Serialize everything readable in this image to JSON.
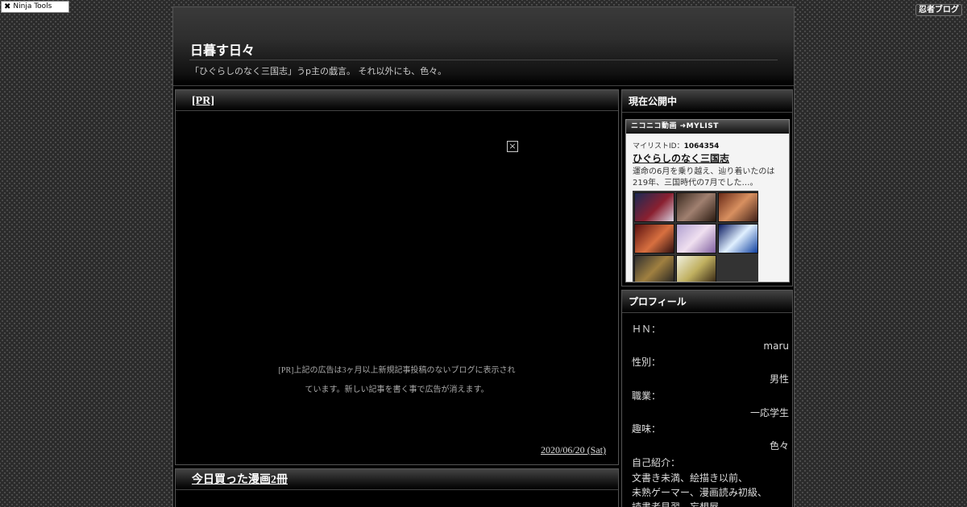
{
  "toolbar": {
    "ninja_tools_label": "Ninja Tools",
    "ninja_blog_label": "忍者ブログ"
  },
  "header": {
    "title": "日暮す日々",
    "description": "「ひぐらしのなく三国志」うp主の戯言。 それ以外にも、色々。"
  },
  "entries": [
    {
      "title": "[PR]",
      "ad_close": "×",
      "notice_line1": "[PR]上記の広告は3ヶ月以上新規記事投稿のないブログに表示され",
      "notice_line2": "ています。新しい記事を書く事で広告が消えます。",
      "date": "2020/06/20 (Sat)"
    },
    {
      "title": "今日買った漫画2冊"
    }
  ],
  "sidebar": {
    "now_public": {
      "heading": "現在公開中",
      "widget_bar": "ニコニコ動画  ➜MYLIST",
      "mylist_id_label": "マイリストID：",
      "mylist_id": "1064354",
      "title": "ひぐらしのなく三国志",
      "description_line1": "運命の6月を乗り越え、辿り着いたのは",
      "description_line2": "219年、三国時代の7月でした…。"
    },
    "profile": {
      "heading": "プロフィール",
      "hn_label": "ＨＮ：",
      "hn_value": "maru",
      "gender_label": "性別：",
      "gender_value": "男性",
      "job_label": "職業：",
      "job_value": "一応学生",
      "hobby_label": "趣味：",
      "hobby_value": "色々",
      "intro_label": "自己紹介：",
      "intro_line1": "文書き未満、絵描き以前、",
      "intro_line2": "未熟ゲーマー、漫画読み初級、",
      "intro_line3": "読書者見習、妄想屋。"
    }
  }
}
